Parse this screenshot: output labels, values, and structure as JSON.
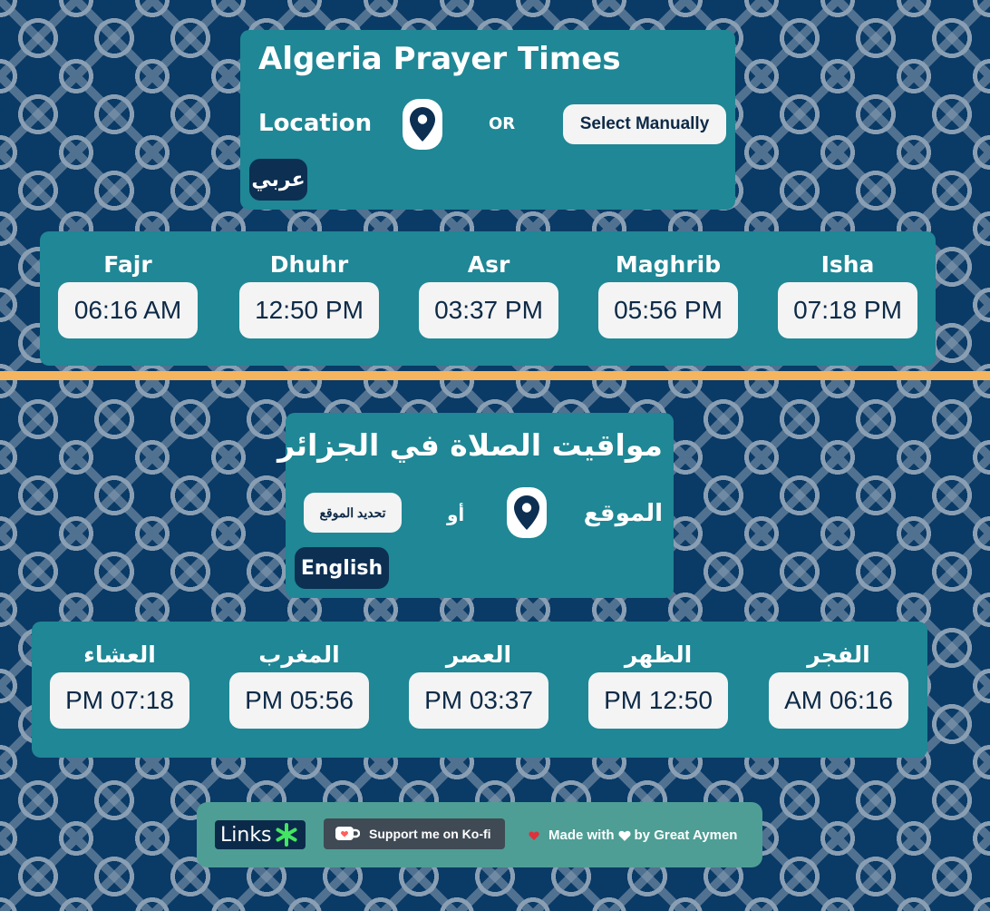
{
  "colors": {
    "background": "#0a3a66",
    "panel": "#1f8795",
    "divider": "#f5b45e",
    "time_box": "#f4f4f4",
    "dark_text": "#0d2a47",
    "lang_button": "#0c2f52",
    "footer": "#4e9e95"
  },
  "english": {
    "title": "Algeria Prayer Times",
    "location_label": "Location",
    "location_icon": "map-pin-icon",
    "or_label": "OR",
    "select_manually": "Select Manually",
    "language_toggle": "عربي",
    "prayers": [
      {
        "name": "Fajr",
        "time": "06:16 AM"
      },
      {
        "name": "Dhuhr",
        "time": "12:50 PM"
      },
      {
        "name": "Asr",
        "time": "03:37 PM"
      },
      {
        "name": "Maghrib",
        "time": "05:56 PM"
      },
      {
        "name": "Isha",
        "time": "07:18 PM"
      }
    ]
  },
  "arabic": {
    "title": "مواقيت الصلاة في الجزائر",
    "location_label": "الموقع",
    "location_icon": "map-pin-icon",
    "or_label": "أو",
    "select_manually": "تحديد الموقع",
    "language_toggle": "English",
    "prayers": [
      {
        "name": "العشاء",
        "time": "PM 07:18"
      },
      {
        "name": "المغرب",
        "time": "PM 05:56"
      },
      {
        "name": "العصر",
        "time": "PM 03:37"
      },
      {
        "name": "الظهر",
        "time": "PM 12:50"
      },
      {
        "name": "الفجر",
        "time": "AM 06:16"
      }
    ]
  },
  "footer": {
    "links_label": "Links",
    "links_icon": "asterisk-icon",
    "kofi_label": "Support me on Ko-fi",
    "kofi_icon": "coffee-cup-icon",
    "made_with_prefix": "Made with",
    "made_with_suffix": "by Great Aymen",
    "heart_icon": "heart-icon"
  }
}
